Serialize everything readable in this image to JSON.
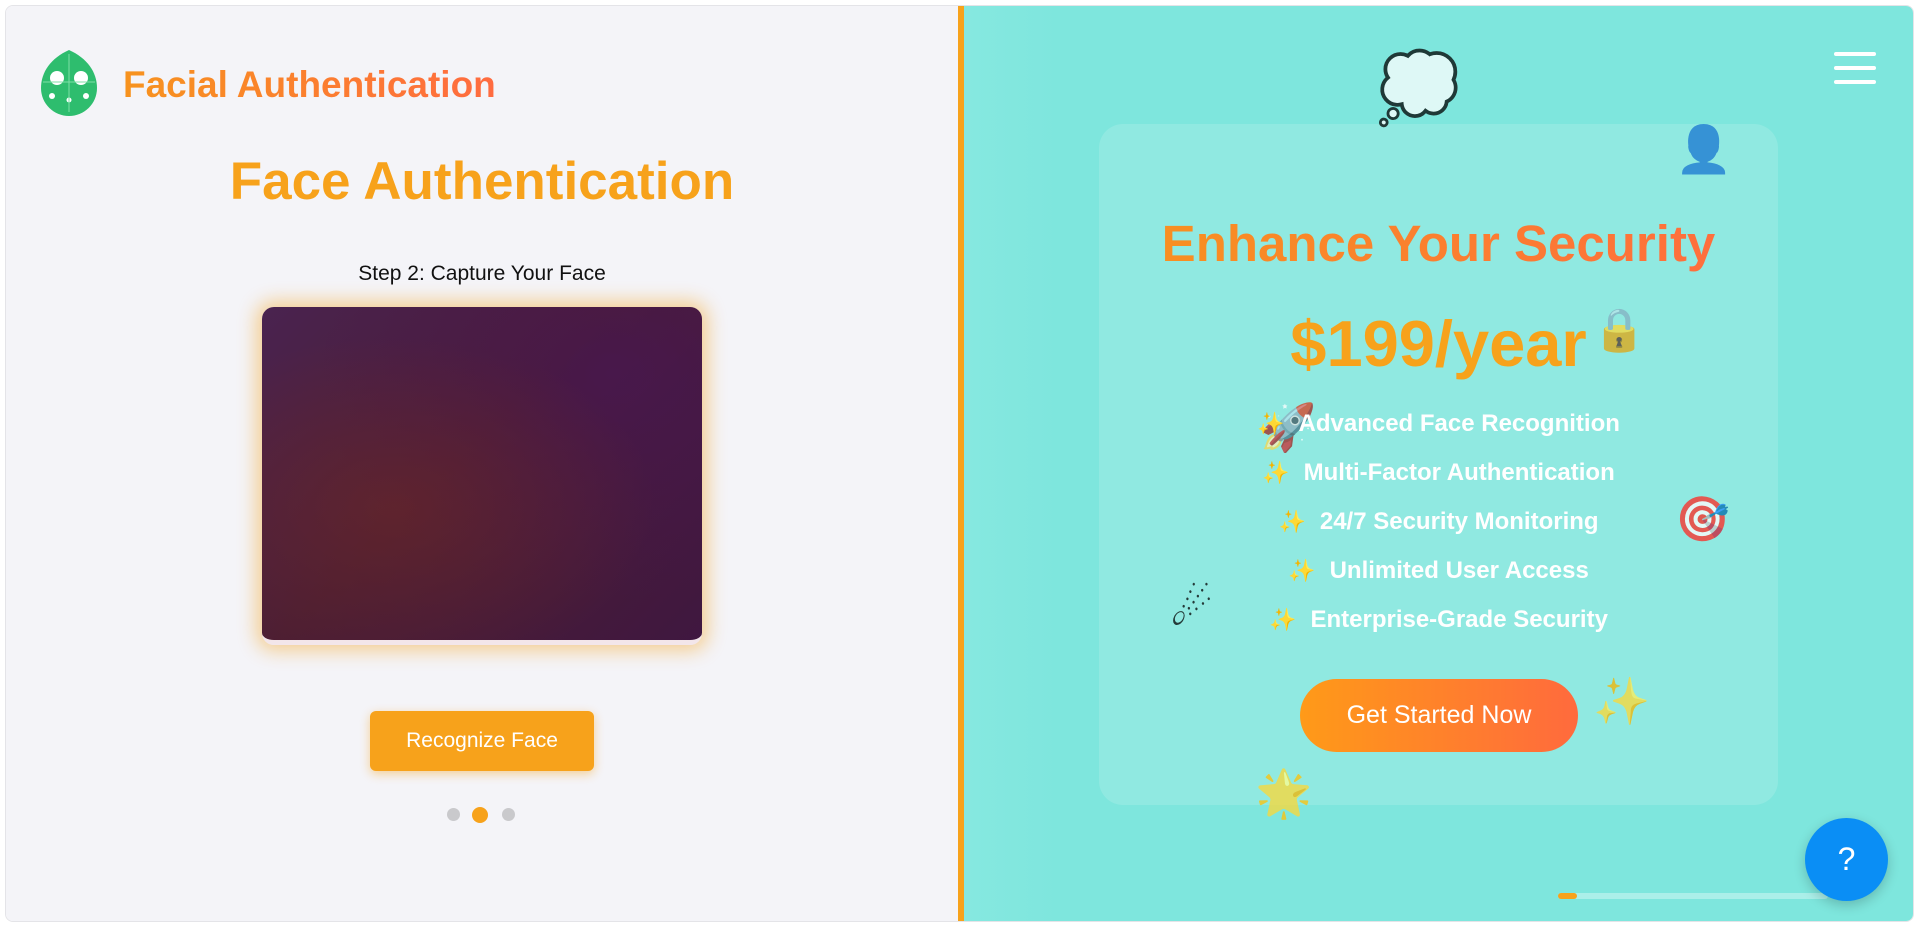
{
  "app": {
    "brand": "Facial Authentication"
  },
  "left": {
    "title": "Face Authentication",
    "step_text": "Step 2: Capture Your Face",
    "recognize_label": "Recognize Face",
    "steps": {
      "total": 3,
      "current": 2
    }
  },
  "promo": {
    "title": "Enhance Your Security",
    "price": "$199/year",
    "features": [
      "Advanced Face Recognition",
      "Multi-Factor Authentication",
      "24/7 Security Monitoring",
      "Unlimited User Access",
      "Enterprise-Grade Security"
    ],
    "feature_bullet": "✨",
    "cta_label": "Get Started Now",
    "progress_fraction": 0.07
  },
  "help": {
    "label": "?"
  },
  "icons": {
    "logo": "face-leaf-logo-icon",
    "menu": "hamburger-menu-icon",
    "decorations": [
      "thought-bubble-icon",
      "user-silhouette-icon",
      "lock-icon",
      "rocket-icon",
      "target-icon",
      "comet-icon",
      "sparkles-icon",
      "burst-icon"
    ]
  },
  "colors": {
    "accent": "#f7a21b",
    "accent_gradient_end": "#ff6b40",
    "left_bg": "#f4f4f8",
    "right_bg": "#7ee6dd",
    "logo_green": "#2ebd6e",
    "help_blue": "#0a8ef5"
  }
}
